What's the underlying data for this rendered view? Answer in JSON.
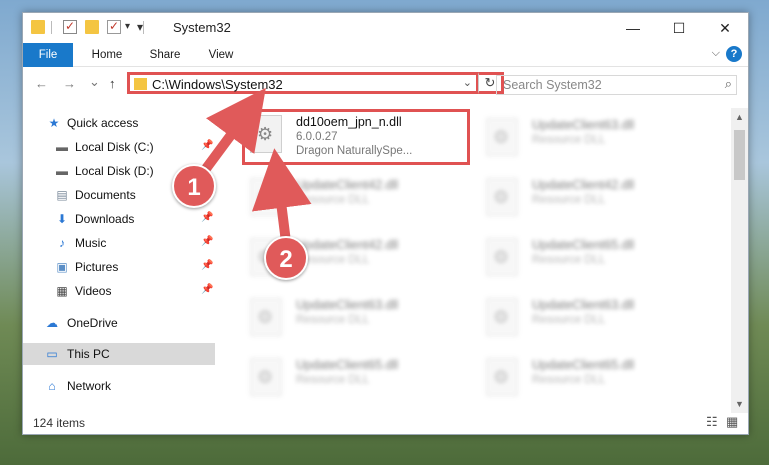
{
  "window": {
    "title": "System32",
    "controls": {
      "minimize": "—",
      "maximize": "☐",
      "close": "✕"
    }
  },
  "ribbon": {
    "tabs": [
      "File",
      "Home",
      "Share",
      "View"
    ],
    "expand": "⌵",
    "help": "?"
  },
  "nav": {
    "back": "←",
    "forward": "→",
    "recent": "⌄",
    "up": "↑",
    "address": "C:\\Windows\\System32",
    "dropdown": "⌄",
    "refresh": "↻",
    "search_placeholder": "Search System32",
    "search_icon": "⌕"
  },
  "sidebar": {
    "items": [
      {
        "label": "Quick access",
        "icon": "★",
        "pinned": false
      },
      {
        "label": "Local Disk (C:)",
        "icon": "▬",
        "pinned": true
      },
      {
        "label": "Local Disk (D:)",
        "icon": "▬",
        "pinned": false
      },
      {
        "label": "Documents",
        "icon": "▤",
        "pinned": true
      },
      {
        "label": "Downloads",
        "icon": "⬇",
        "pinned": true
      },
      {
        "label": "Music",
        "icon": "♪",
        "pinned": true
      },
      {
        "label": "Pictures",
        "icon": "▣",
        "pinned": true
      },
      {
        "label": "Videos",
        "icon": "▦",
        "pinned": true
      },
      {
        "label": "OneDrive",
        "icon": "☁",
        "pinned": false
      },
      {
        "label": "This PC",
        "icon": "▭",
        "pinned": false,
        "selected": true
      },
      {
        "label": "Network",
        "icon": "⌂",
        "pinned": false
      }
    ],
    "pin_glyph": "📌"
  },
  "files": [
    {
      "name": "dd10oem_jpn_n.dll",
      "line1": "6.0.0.27",
      "line2": "Dragon NaturallySpe...",
      "highlighted": true
    },
    {
      "name": "UpdateClient63.dll",
      "line1": "Resource DLL",
      "line2": ""
    },
    {
      "name": "UpdateClient42.dll",
      "line1": "Resource DLL",
      "line2": ""
    },
    {
      "name": "UpdateClient42.dll",
      "line1": "Resource DLL",
      "line2": ""
    },
    {
      "name": "UpdateClient42.dll",
      "line1": "Resource DLL",
      "line2": ""
    },
    {
      "name": "UpdateClient65.dll",
      "line1": "Resource DLL",
      "line2": ""
    },
    {
      "name": "UpdateClient63.dll",
      "line1": "Resource DLL",
      "line2": ""
    },
    {
      "name": "UpdateClient63.dll",
      "line1": "Resource DLL",
      "line2": ""
    },
    {
      "name": "UpdateClient65.dll",
      "line1": "Resource DLL",
      "line2": ""
    },
    {
      "name": "UpdateClient65.dll",
      "line1": "Resource DLL",
      "line2": ""
    }
  ],
  "status": {
    "item_count": "124 items"
  },
  "annotations": {
    "badge1": "1",
    "badge2": "2"
  },
  "colors": {
    "accent": "#1979ca",
    "highlight": "#e05252",
    "badge": "#e05a5a"
  }
}
